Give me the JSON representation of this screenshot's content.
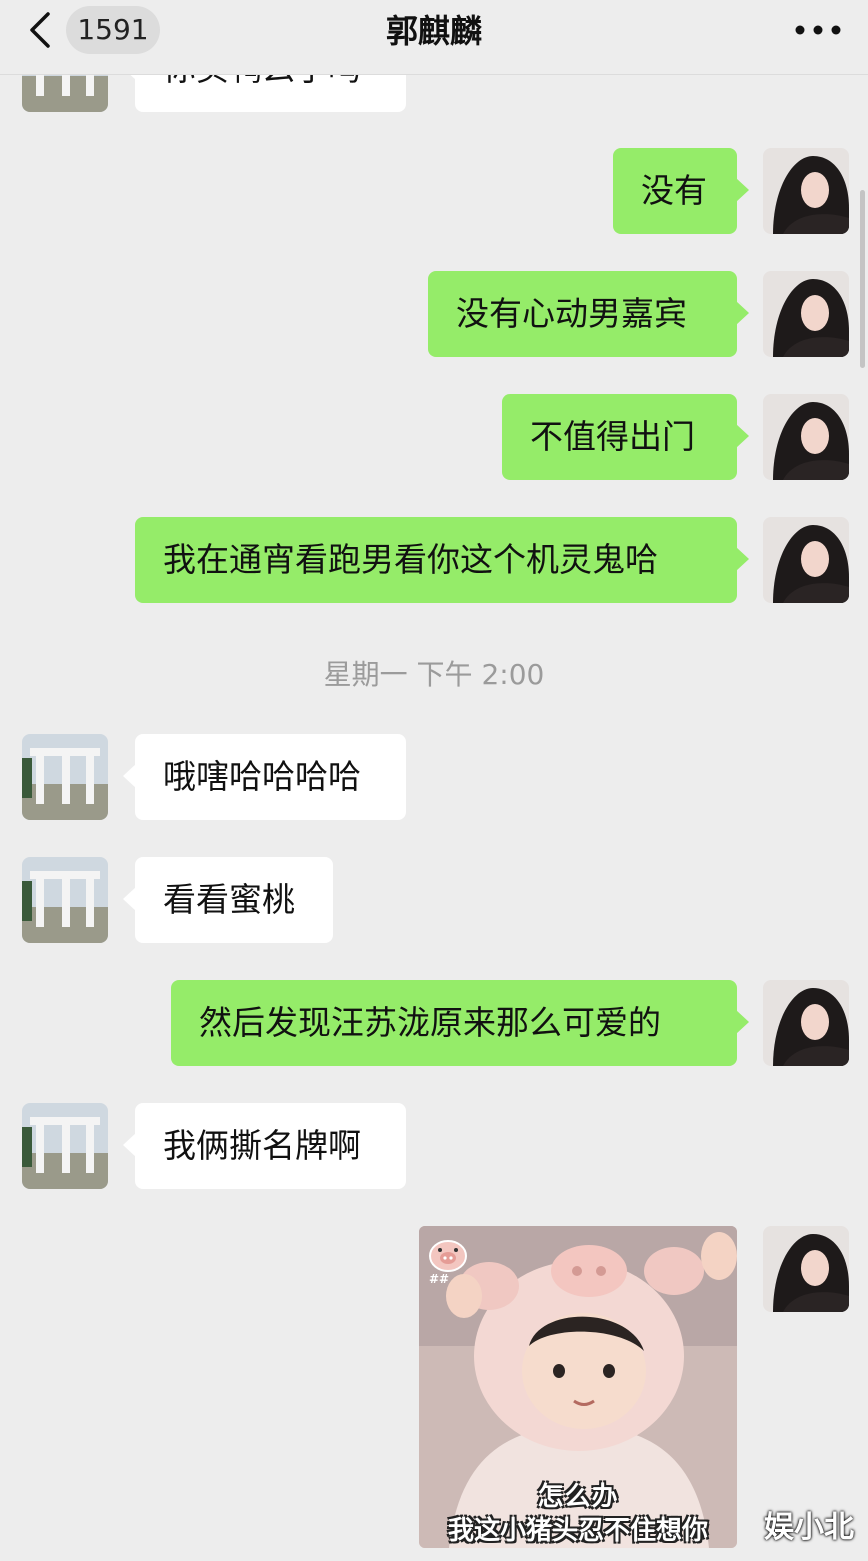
{
  "header": {
    "unread_count": "1591",
    "title": "郭麒麟"
  },
  "messages": [
    {
      "side": "left",
      "text": "你买鸭么了吗"
    },
    {
      "side": "right",
      "text": "没有"
    },
    {
      "side": "right",
      "text": "没有心动男嘉宾"
    },
    {
      "side": "right",
      "text": "不值得出门"
    },
    {
      "side": "right",
      "text": "我在通宵看跑男看你这个机灵鬼哈"
    },
    {
      "side": "left",
      "text": "哦嗐哈哈哈哈"
    },
    {
      "side": "left",
      "text": "看看蜜桃"
    },
    {
      "side": "right",
      "text": "然后发现汪苏泷原来那么可爱的"
    },
    {
      "side": "left",
      "text": "我俩撕名牌啊"
    }
  ],
  "timestamp": "星期一 下午 2:00",
  "sticker": {
    "caption_line1": "怎么办",
    "caption_line2": "我这小猪头忍不住想你",
    "badge_text": "##"
  },
  "watermark": "娱小北",
  "colors": {
    "background": "#ededed",
    "bubble_self": "#95ec69",
    "bubble_other": "#ffffff"
  },
  "icons": {
    "back": "chevron-left-icon",
    "more": "ellipsis-icon"
  }
}
